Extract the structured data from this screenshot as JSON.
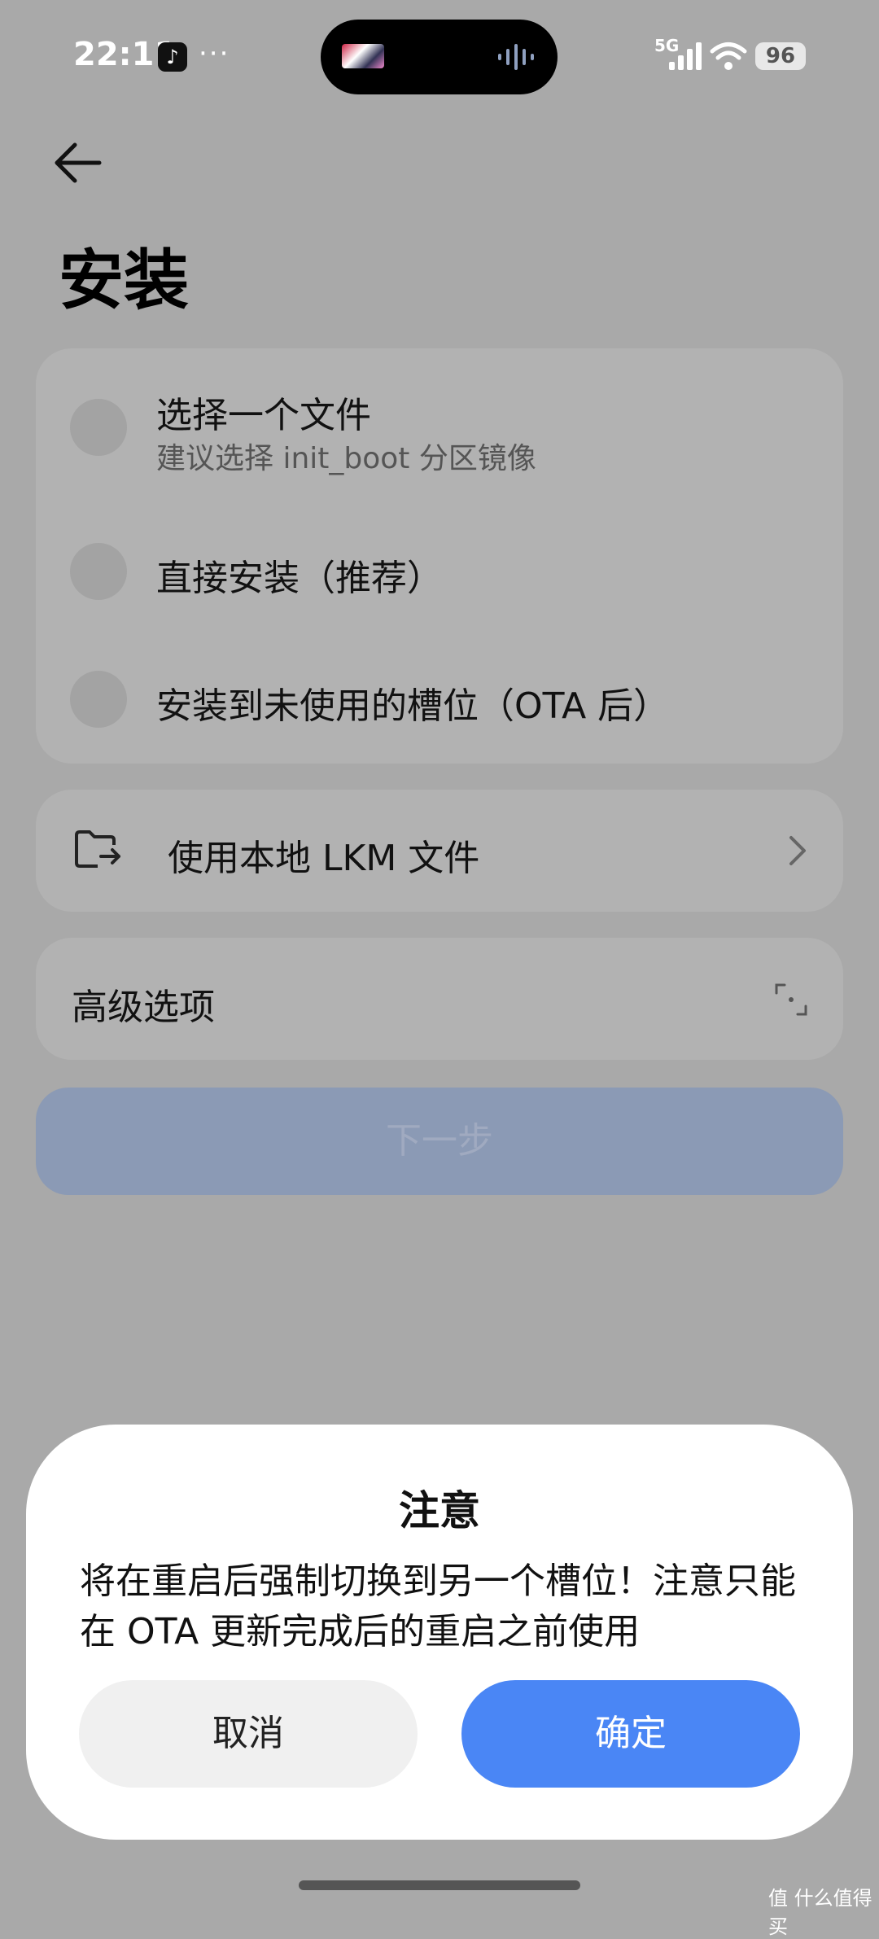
{
  "status_bar": {
    "time": "22:11",
    "network": "5G",
    "battery": "96",
    "icons": [
      "tiktok-icon",
      "more-dots-icon",
      "signal-icon",
      "wifi-icon",
      "battery-icon"
    ]
  },
  "header": {
    "back_icon": "arrow-left-icon",
    "title": "安装"
  },
  "install_options": [
    {
      "title": "选择一个文件",
      "subtitle": "建议选择 init_boot 分区镜像"
    },
    {
      "title": "直接安装（推荐）"
    },
    {
      "title": "安装到未使用的槽位（OTA 后）"
    }
  ],
  "lkm_row": {
    "label": "使用本地 LKM 文件",
    "icon": "folder-export-icon",
    "chevron": "chevron-right-icon"
  },
  "advanced_row": {
    "label": "高级选项",
    "icon": "expand-icon"
  },
  "next_button": "下一步",
  "dialog": {
    "title": "注意",
    "message": "将在重启后强制切换到另一个槽位！注意只能在 OTA 更新完成后的重启之前使用",
    "cancel": "取消",
    "confirm": "确定"
  },
  "watermark": "值 什么值得买",
  "colors": {
    "overlay_bg": "#a9a9a9",
    "accent": "#4a86f5",
    "dialog_bg": "#ffffff"
  }
}
